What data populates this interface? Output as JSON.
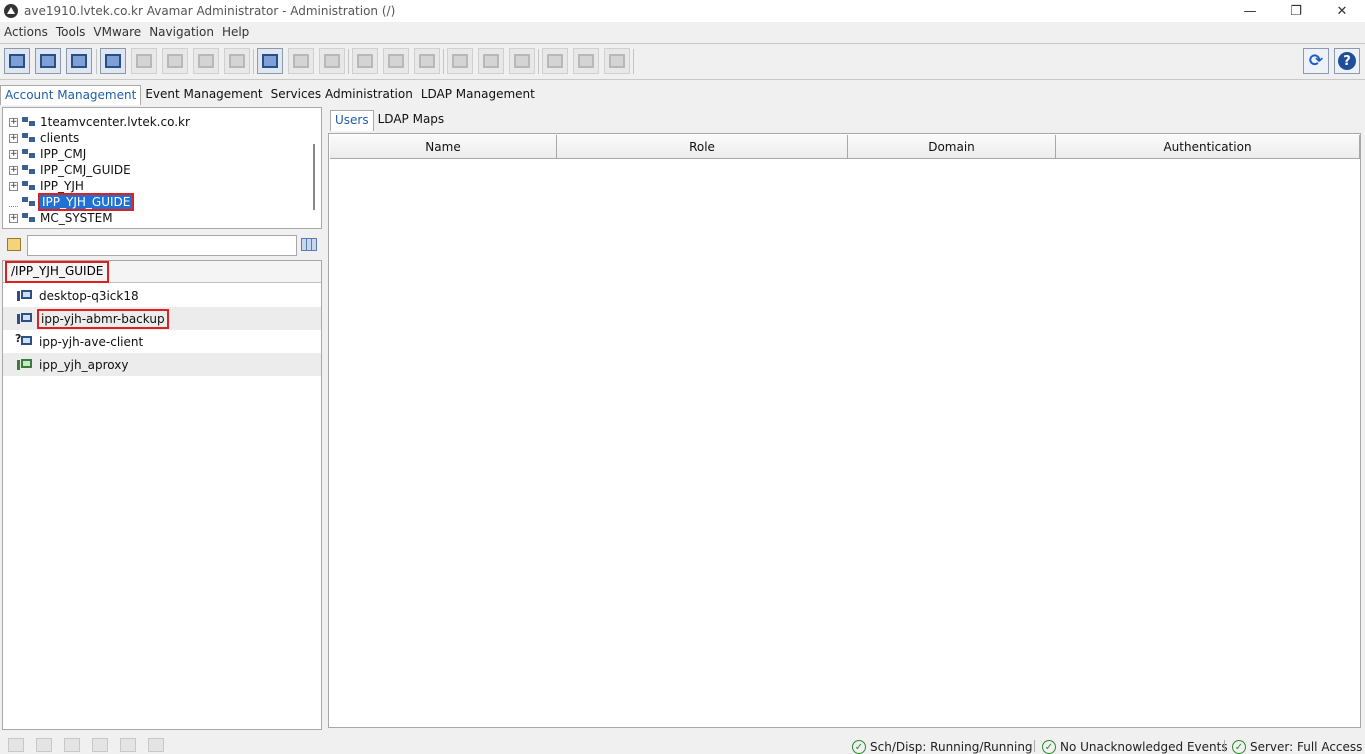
{
  "window": {
    "title": "ave1910.lvtek.co.kr Avamar Administrator - Administration (/)",
    "controls": {
      "minimize": "—",
      "restore": "❐",
      "close": "✕"
    }
  },
  "menu": [
    "Actions",
    "Tools",
    "VMware",
    "Navigation",
    "Help"
  ],
  "toolbar": {
    "buttons": [
      {
        "icon": "new-account-icon",
        "state": "active"
      },
      {
        "icon": "find-client-icon",
        "state": "active"
      },
      {
        "icon": "delete-account-icon",
        "state": "active"
      },
      {
        "icon": "new-client-icon",
        "state": "active"
      },
      {
        "icon": "edit-client-icon",
        "state": "disabled"
      },
      {
        "icon": "move-client-icon",
        "state": "disabled"
      },
      {
        "icon": "retire-client-icon",
        "state": "disabled"
      },
      {
        "icon": "client-group-icon",
        "state": "disabled"
      },
      {
        "icon": "new-user-icon",
        "state": "active"
      },
      {
        "icon": "edit-user-icon",
        "state": "disabled"
      },
      {
        "icon": "delete-user-icon",
        "state": "disabled"
      },
      {
        "icon": "users-group-icon",
        "state": "disabled"
      },
      {
        "icon": "users-add-icon",
        "state": "disabled"
      },
      {
        "icon": "users-remove-icon",
        "state": "disabled"
      },
      {
        "icon": "tree-node-icon",
        "state": "disabled"
      },
      {
        "icon": "split-view-icon",
        "state": "disabled"
      },
      {
        "icon": "list-view-icon",
        "state": "disabled"
      },
      {
        "icon": "pointer-icon",
        "state": "disabled"
      },
      {
        "icon": "select-icon",
        "state": "disabled"
      },
      {
        "icon": "checklist-icon",
        "state": "disabled"
      }
    ],
    "refresh_icon": "refresh-icon",
    "help_icon": "help-icon",
    "help_glyph": "?",
    "refresh_glyph": "⟳"
  },
  "main_tabs": [
    {
      "label": "Account Management",
      "active": true
    },
    {
      "label": "Event Management",
      "active": false
    },
    {
      "label": "Services Administration",
      "active": false
    },
    {
      "label": "LDAP Management",
      "active": false
    }
  ],
  "tree": {
    "nodes": [
      {
        "label": "1teamvcenter.lvtek.co.kr",
        "expandable": true,
        "selected": false
      },
      {
        "label": "clients",
        "expandable": true,
        "selected": false
      },
      {
        "label": "IPP_CMJ",
        "expandable": true,
        "selected": false
      },
      {
        "label": "IPP_CMJ_GUIDE",
        "expandable": true,
        "selected": false
      },
      {
        "label": "IPP_YJH",
        "expandable": true,
        "selected": false
      },
      {
        "label": "IPP_YJH_GUIDE",
        "expandable": false,
        "selected": true
      },
      {
        "label": "MC_SYSTEM",
        "expandable": true,
        "selected": false
      }
    ]
  },
  "filter": {
    "value": "",
    "placeholder": ""
  },
  "client_list": {
    "path": "/IPP_YJH_GUIDE",
    "clients": [
      {
        "name": "desktop-q3ick18",
        "icon": "client-icon",
        "highlight": false
      },
      {
        "name": "ipp-yjh-abmr-backup",
        "icon": "client-icon",
        "highlight": true
      },
      {
        "name": "ipp-yjh-ave-client",
        "icon": "unknown-client-icon",
        "highlight": false
      },
      {
        "name": "ipp_yjh_aproxy",
        "icon": "proxy-client-icon",
        "highlight": false
      }
    ]
  },
  "right_panel": {
    "sub_tabs": [
      {
        "label": "Users",
        "active": true
      },
      {
        "label": "LDAP Maps",
        "active": false
      }
    ],
    "columns": [
      "Name",
      "Role",
      "Domain",
      "Authentication"
    ]
  },
  "statusbar": {
    "items": [
      "Sch/Disp: Running/Running",
      "No Unacknowledged Events",
      "Server: Full Access"
    ],
    "check_glyph": "✓"
  },
  "colors": {
    "selection": "#1f72d4",
    "highlight_box": "#e02020",
    "active_tab_text": "#1f5ea8"
  }
}
